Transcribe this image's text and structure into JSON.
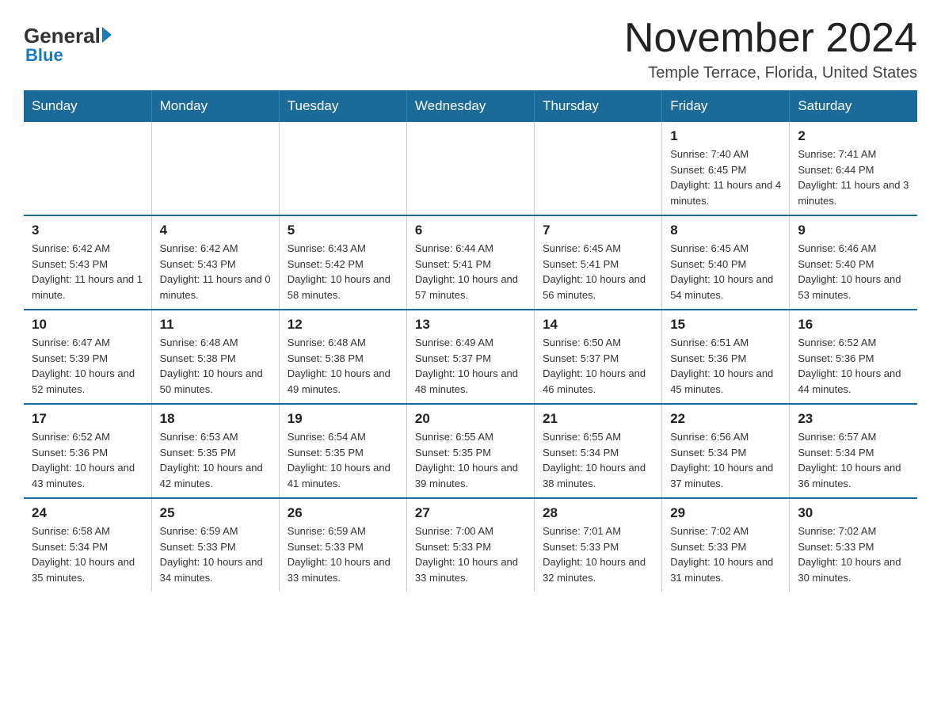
{
  "logo": {
    "general": "General",
    "blue": "Blue"
  },
  "title": "November 2024",
  "subtitle": "Temple Terrace, Florida, United States",
  "days_of_week": [
    "Sunday",
    "Monday",
    "Tuesday",
    "Wednesday",
    "Thursday",
    "Friday",
    "Saturday"
  ],
  "weeks": [
    [
      {
        "day": "",
        "info": ""
      },
      {
        "day": "",
        "info": ""
      },
      {
        "day": "",
        "info": ""
      },
      {
        "day": "",
        "info": ""
      },
      {
        "day": "",
        "info": ""
      },
      {
        "day": "1",
        "info": "Sunrise: 7:40 AM\nSunset: 6:45 PM\nDaylight: 11 hours and 4 minutes."
      },
      {
        "day": "2",
        "info": "Sunrise: 7:41 AM\nSunset: 6:44 PM\nDaylight: 11 hours and 3 minutes."
      }
    ],
    [
      {
        "day": "3",
        "info": "Sunrise: 6:42 AM\nSunset: 5:43 PM\nDaylight: 11 hours and 1 minute."
      },
      {
        "day": "4",
        "info": "Sunrise: 6:42 AM\nSunset: 5:43 PM\nDaylight: 11 hours and 0 minutes."
      },
      {
        "day": "5",
        "info": "Sunrise: 6:43 AM\nSunset: 5:42 PM\nDaylight: 10 hours and 58 minutes."
      },
      {
        "day": "6",
        "info": "Sunrise: 6:44 AM\nSunset: 5:41 PM\nDaylight: 10 hours and 57 minutes."
      },
      {
        "day": "7",
        "info": "Sunrise: 6:45 AM\nSunset: 5:41 PM\nDaylight: 10 hours and 56 minutes."
      },
      {
        "day": "8",
        "info": "Sunrise: 6:45 AM\nSunset: 5:40 PM\nDaylight: 10 hours and 54 minutes."
      },
      {
        "day": "9",
        "info": "Sunrise: 6:46 AM\nSunset: 5:40 PM\nDaylight: 10 hours and 53 minutes."
      }
    ],
    [
      {
        "day": "10",
        "info": "Sunrise: 6:47 AM\nSunset: 5:39 PM\nDaylight: 10 hours and 52 minutes."
      },
      {
        "day": "11",
        "info": "Sunrise: 6:48 AM\nSunset: 5:38 PM\nDaylight: 10 hours and 50 minutes."
      },
      {
        "day": "12",
        "info": "Sunrise: 6:48 AM\nSunset: 5:38 PM\nDaylight: 10 hours and 49 minutes."
      },
      {
        "day": "13",
        "info": "Sunrise: 6:49 AM\nSunset: 5:37 PM\nDaylight: 10 hours and 48 minutes."
      },
      {
        "day": "14",
        "info": "Sunrise: 6:50 AM\nSunset: 5:37 PM\nDaylight: 10 hours and 46 minutes."
      },
      {
        "day": "15",
        "info": "Sunrise: 6:51 AM\nSunset: 5:36 PM\nDaylight: 10 hours and 45 minutes."
      },
      {
        "day": "16",
        "info": "Sunrise: 6:52 AM\nSunset: 5:36 PM\nDaylight: 10 hours and 44 minutes."
      }
    ],
    [
      {
        "day": "17",
        "info": "Sunrise: 6:52 AM\nSunset: 5:36 PM\nDaylight: 10 hours and 43 minutes."
      },
      {
        "day": "18",
        "info": "Sunrise: 6:53 AM\nSunset: 5:35 PM\nDaylight: 10 hours and 42 minutes."
      },
      {
        "day": "19",
        "info": "Sunrise: 6:54 AM\nSunset: 5:35 PM\nDaylight: 10 hours and 41 minutes."
      },
      {
        "day": "20",
        "info": "Sunrise: 6:55 AM\nSunset: 5:35 PM\nDaylight: 10 hours and 39 minutes."
      },
      {
        "day": "21",
        "info": "Sunrise: 6:55 AM\nSunset: 5:34 PM\nDaylight: 10 hours and 38 minutes."
      },
      {
        "day": "22",
        "info": "Sunrise: 6:56 AM\nSunset: 5:34 PM\nDaylight: 10 hours and 37 minutes."
      },
      {
        "day": "23",
        "info": "Sunrise: 6:57 AM\nSunset: 5:34 PM\nDaylight: 10 hours and 36 minutes."
      }
    ],
    [
      {
        "day": "24",
        "info": "Sunrise: 6:58 AM\nSunset: 5:34 PM\nDaylight: 10 hours and 35 minutes."
      },
      {
        "day": "25",
        "info": "Sunrise: 6:59 AM\nSunset: 5:33 PM\nDaylight: 10 hours and 34 minutes."
      },
      {
        "day": "26",
        "info": "Sunrise: 6:59 AM\nSunset: 5:33 PM\nDaylight: 10 hours and 33 minutes."
      },
      {
        "day": "27",
        "info": "Sunrise: 7:00 AM\nSunset: 5:33 PM\nDaylight: 10 hours and 33 minutes."
      },
      {
        "day": "28",
        "info": "Sunrise: 7:01 AM\nSunset: 5:33 PM\nDaylight: 10 hours and 32 minutes."
      },
      {
        "day": "29",
        "info": "Sunrise: 7:02 AM\nSunset: 5:33 PM\nDaylight: 10 hours and 31 minutes."
      },
      {
        "day": "30",
        "info": "Sunrise: 7:02 AM\nSunset: 5:33 PM\nDaylight: 10 hours and 30 minutes."
      }
    ]
  ]
}
